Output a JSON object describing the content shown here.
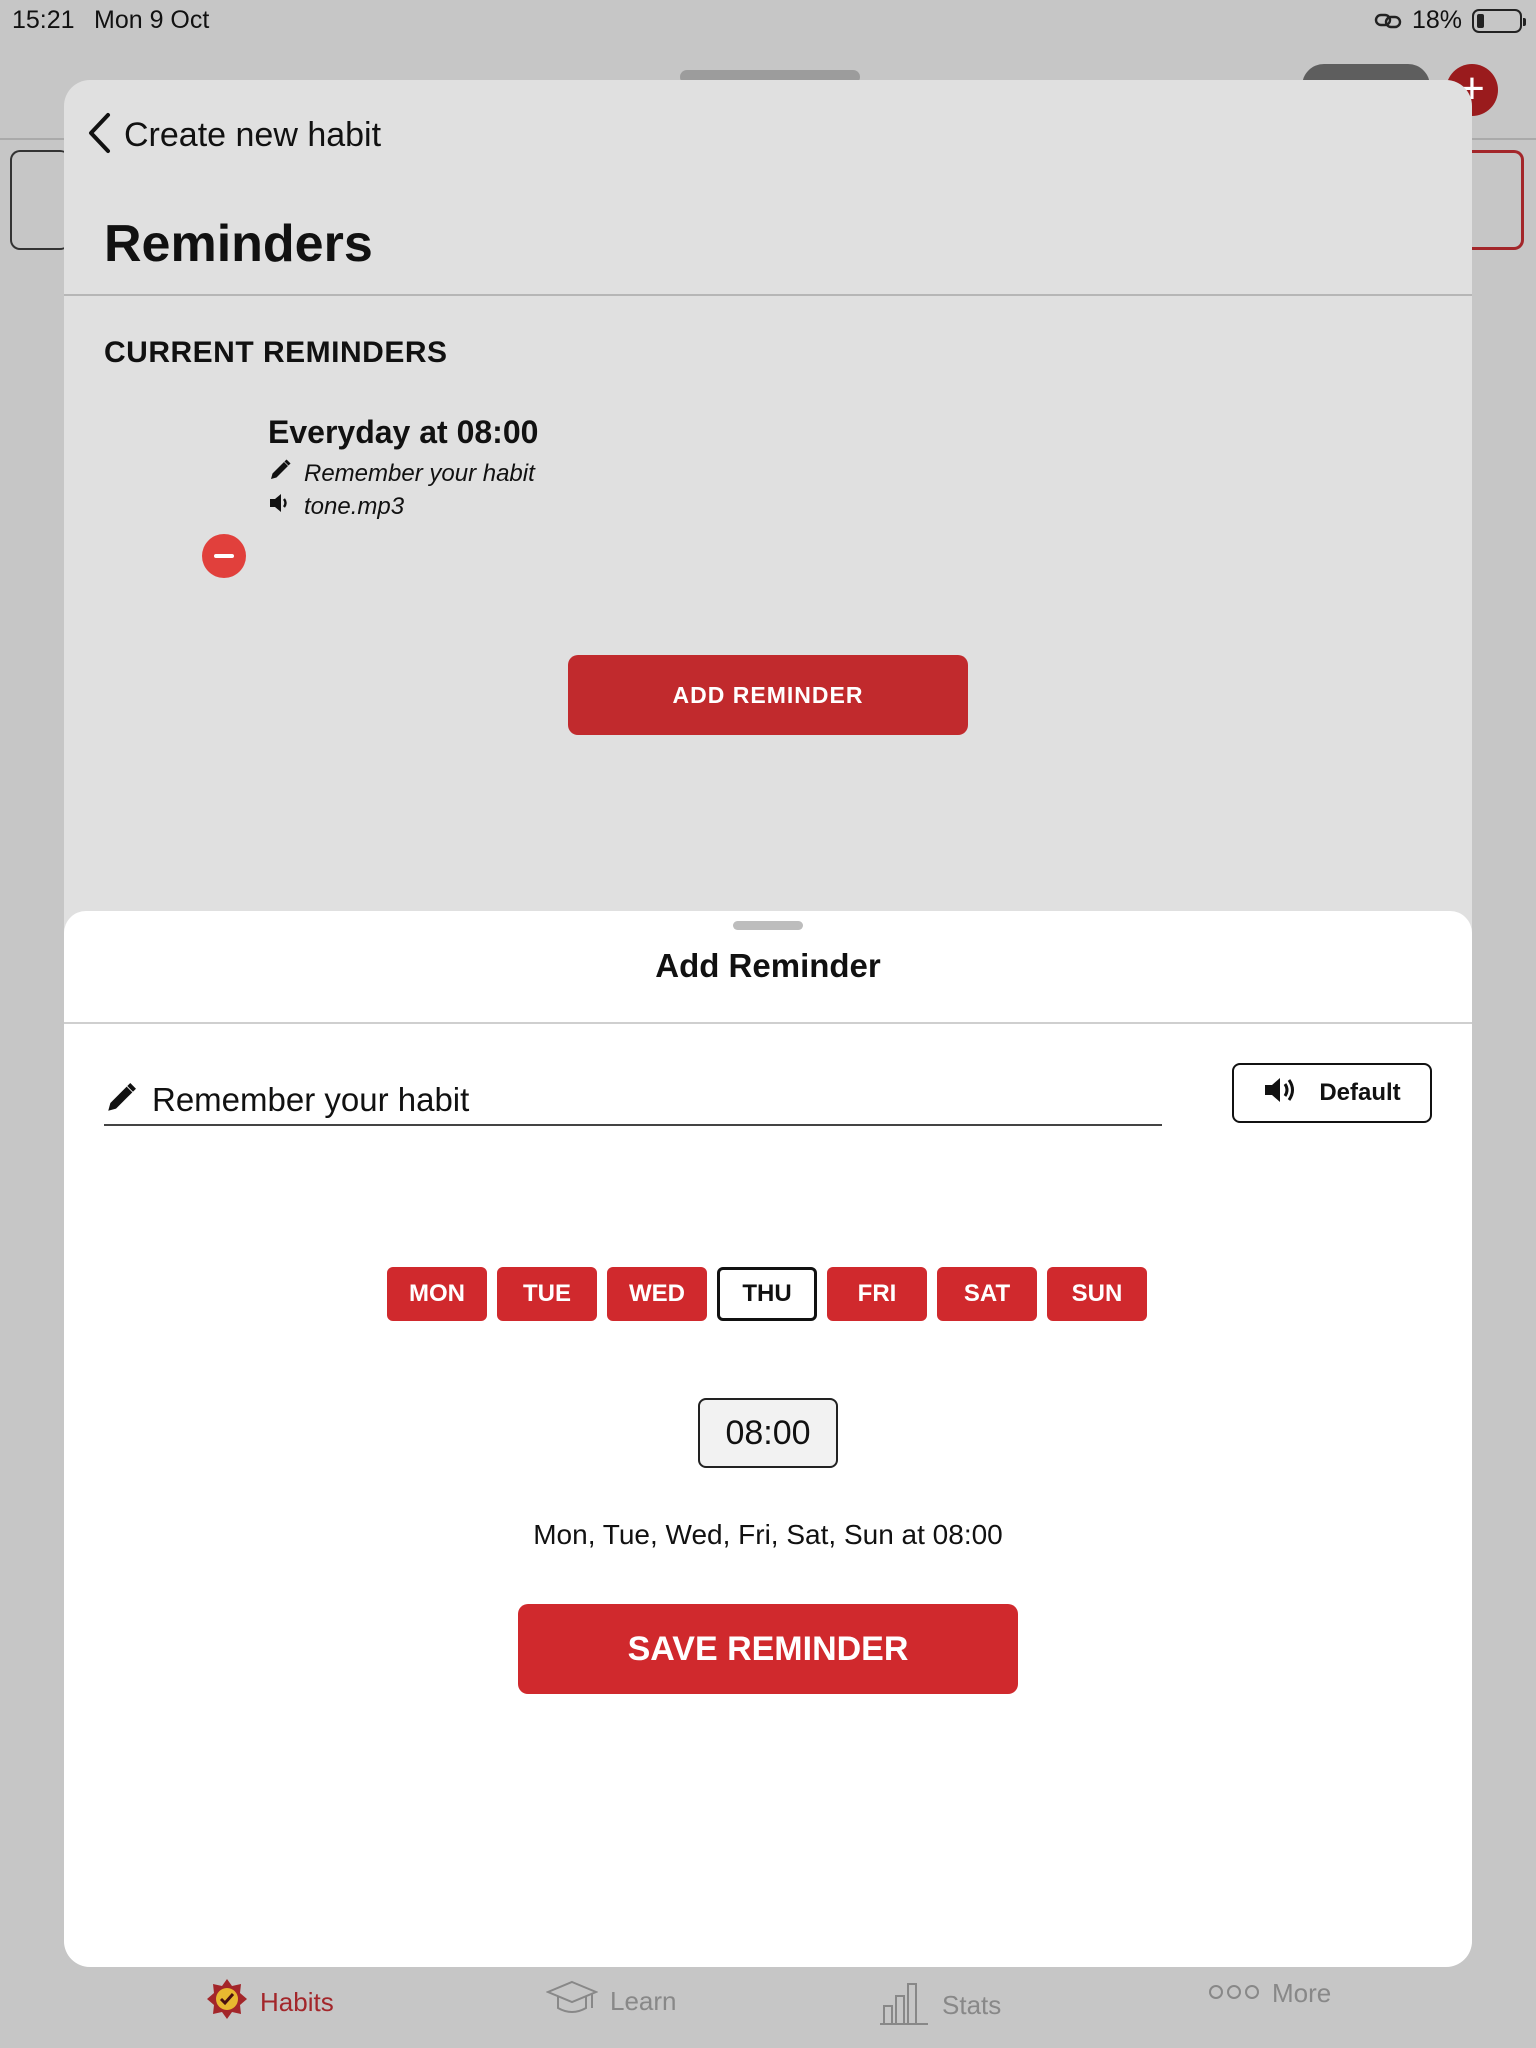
{
  "status_bar": {
    "time": "15:21",
    "date": "Mon 9 Oct",
    "battery": "18%",
    "battery_level": 0.18
  },
  "nav": {
    "back_label": "Create new habit",
    "title": "Reminders"
  },
  "current_reminders": {
    "header": "CURRENT REMINDERS",
    "items": [
      {
        "schedule": "Everyday at 08:00",
        "message": "Remember your habit",
        "sound": "tone.mp3"
      }
    ]
  },
  "add_reminder_button": "ADD REMINDER",
  "add_panel": {
    "title": "Add Reminder",
    "message_value": "Remember your habit",
    "sound_label": "Default",
    "days": [
      {
        "label": "MON",
        "selected": true
      },
      {
        "label": "TUE",
        "selected": true
      },
      {
        "label": "WED",
        "selected": true
      },
      {
        "label": "THU",
        "selected": false
      },
      {
        "label": "FRI",
        "selected": true
      },
      {
        "label": "SAT",
        "selected": true
      },
      {
        "label": "SUN",
        "selected": true
      }
    ],
    "time": "08:00",
    "summary": "Mon, Tue, Wed, Fri, Sat, Sun at 08:00",
    "save_label": "SAVE REMINDER"
  },
  "tab_bar": {
    "items": [
      {
        "label": "Habits",
        "icon": "habits-icon",
        "active": true
      },
      {
        "label": "Learn",
        "icon": "graduation-cap-icon",
        "active": false
      },
      {
        "label": "Stats",
        "icon": "bar-chart-icon",
        "active": false
      },
      {
        "label": "More",
        "icon": "more-dots-icon",
        "active": false
      }
    ]
  },
  "colors": {
    "accent": "#d0292d",
    "accent_dark": "#c12a2d",
    "tab_active": "#a3262a",
    "remove": "#e1403c",
    "sheet_bg": "#e0e0e0",
    "dim_bg": "#c6c6c6"
  }
}
